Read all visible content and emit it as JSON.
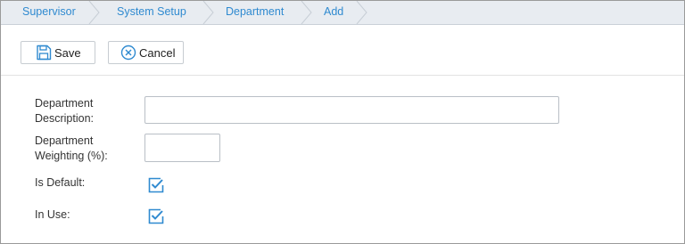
{
  "breadcrumb": {
    "items": [
      {
        "label": "Supervisor"
      },
      {
        "label": "System Setup"
      },
      {
        "label": "Department"
      },
      {
        "label": "Add"
      }
    ]
  },
  "toolbar": {
    "save_label": "Save",
    "cancel_label": "Cancel"
  },
  "form": {
    "description_label": "Department\nDescription:",
    "description_value": "",
    "weighting_label": "Department\nWeighting (%):",
    "weighting_value": "",
    "is_default_label": "Is Default:",
    "is_default_checked": true,
    "in_use_label": "In Use:",
    "in_use_checked": true
  },
  "colors": {
    "accent": "#2f8ad0",
    "breadcrumb_bg": "#e8ecf1"
  }
}
